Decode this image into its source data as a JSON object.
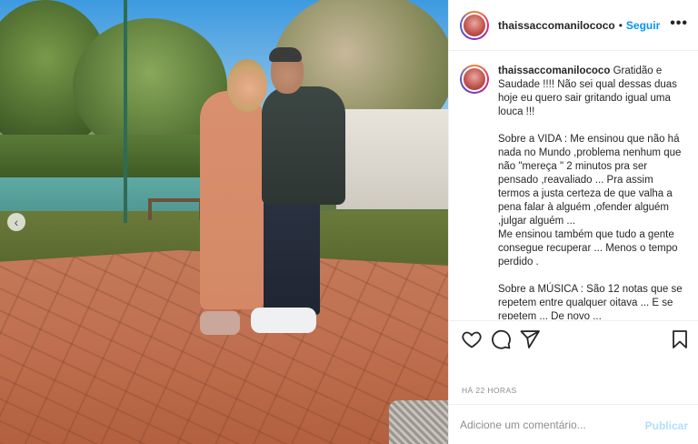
{
  "post": {
    "username": "thaissaccomanilococo",
    "follow_label": "Seguir",
    "separator": "•",
    "more_label": "•••",
    "caption_text": "Gratidão e Saudade !!!! Não sei qual dessas duas hoje eu quero sair gritando igual uma louca !!!\n\nSobre a VIDA : Me ensinou que não há nada no Mundo ,problema nenhum que não \"mereça \" 2 minutos pra ser pensado ,reavaliado ... Pra assim termos a justa certeza de que valha a pena falar à alguém ,ofender alguém ,julgar alguém ...\nMe ensinou também que tudo a gente consegue recuperar ... Menos o tempo perdido .\n\nSobre a MÚSICA : São 12 notas que se repetem entre qualquer oitava ... E se repetem ... De novo ...",
    "timestamp": "HÁ 22 HORAS",
    "carousel_prev_icon": "‹"
  },
  "comment": {
    "placeholder": "Adicione um comentário...",
    "publish_label": "Publicar"
  },
  "icons": {
    "like": "heart-icon",
    "comment": "comment-bubble-icon",
    "share": "paper-plane-icon",
    "save": "bookmark-icon"
  },
  "colors": {
    "follow_blue": "#0095f6",
    "publish_disabled": "#b2dffc",
    "muted_text": "#8e8e8e",
    "divider": "#efefef"
  }
}
